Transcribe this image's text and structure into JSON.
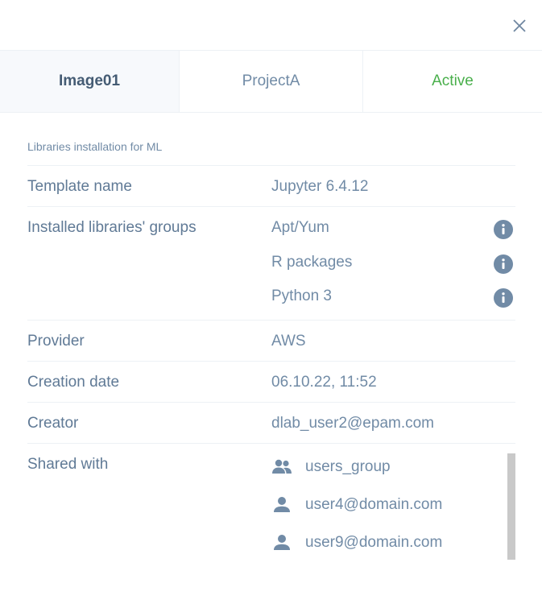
{
  "header": {
    "close_icon": "close-icon"
  },
  "tabs": {
    "name": "Image01",
    "project": "ProjectA",
    "status": "Active"
  },
  "description": "Libraries installation for ML",
  "details": {
    "template_label": "Template name",
    "template_value": "Jupyter 6.4.12",
    "libraries_label": "Installed libraries' groups",
    "libraries": [
      "Apt/Yum",
      "R packages",
      "Python 3"
    ],
    "provider_label": "Provider",
    "provider_value": "AWS",
    "creation_label": "Creation date",
    "creation_value": "06.10.22, 11:52",
    "creator_label": "Creator",
    "creator_value": "dlab_user2@epam.com",
    "shared_label": "Shared with",
    "shared": [
      {
        "name": "users_group",
        "icon": "group-icon"
      },
      {
        "name": "user4@domain.com",
        "icon": "user-icon"
      },
      {
        "name": "user9@domain.com",
        "icon": "user-icon"
      }
    ]
  },
  "colors": {
    "status_active": "#49af4b",
    "icon_fill": "#718ba6"
  }
}
